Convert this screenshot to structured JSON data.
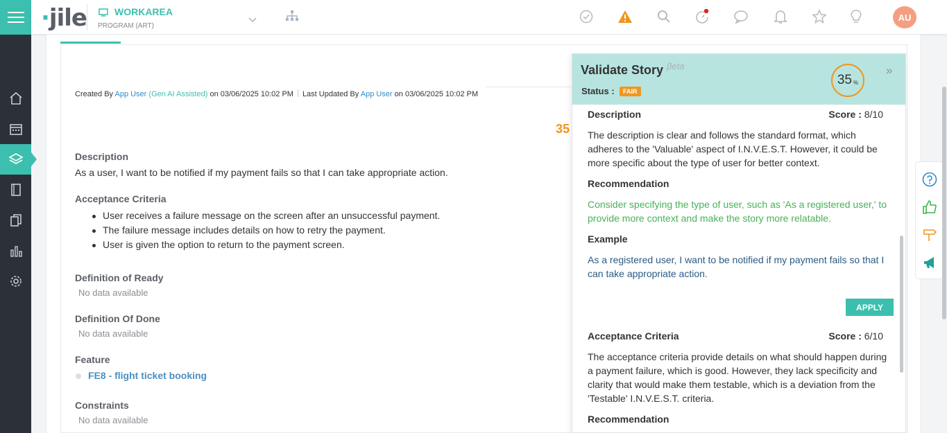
{
  "app": {
    "logo": "jile",
    "workarea_label": "WORKAREA",
    "program_label": "PROGRAM (ART)",
    "avatar_initials": "AU"
  },
  "colors": {
    "brand": "#3cbfae",
    "warning": "#f0961e",
    "link": "#2e8bc9"
  },
  "rail": {
    "items": [
      {
        "icon": "home-icon"
      },
      {
        "icon": "calendar-icon"
      },
      {
        "icon": "layers-icon",
        "active": true
      },
      {
        "icon": "notebook-icon"
      },
      {
        "icon": "documents-icon"
      },
      {
        "icon": "bar-chart-icon"
      },
      {
        "icon": "gear-icon"
      }
    ]
  },
  "topbar_icons": [
    "check-circle-icon",
    "warning-icon",
    "search-icon",
    "timer-icon",
    "chat-icon",
    "bell-icon",
    "star-icon",
    "lightbulb-icon"
  ],
  "story": {
    "meta": {
      "created_by_prefix": "Created By",
      "created_by_user": "App User",
      "created_by_note": "(Gen AI Assisted)",
      "created_on": "on 03/06/2025 10:02 PM",
      "updated_prefix": "Last Updated By",
      "updated_by_user": "App User",
      "updated_on": "on 03/06/2025 10:02 PM"
    },
    "score": "35",
    "description_label": "Description",
    "description": "As a user, I want to be notified if my payment fails so that I can take appropriate action.",
    "ac_label": "Acceptance Criteria",
    "ac_items": [
      "User receives a failure message on the screen after an unsuccessful payment.",
      "The failure message includes details on how to retry the payment.",
      "User is given the option to return to the payment screen."
    ],
    "dor_label": "Definition of Ready",
    "dor_value": "No data available",
    "dod_label": "Definition Of Done",
    "dod_value": "No data available",
    "feature_label": "Feature",
    "feature_value": "FE8 - flight ticket booking",
    "constraints_label": "Constraints",
    "constraints_value": "No data available"
  },
  "validate": {
    "title": "Validate Story",
    "beta": "βeta",
    "status_label": "Status :",
    "status_value": "FAIR",
    "score": "35",
    "score_unit": "%",
    "description": {
      "heading": "Description",
      "score_label": "Score :",
      "score_value": "8/10",
      "text": "The description is clear and follows the standard format, which adheres to the 'Valuable' aspect of I.N.V.E.S.T. However, it could be more specific about the type of user for better context.",
      "rec_heading": "Recommendation",
      "recommendation": "Consider specifying the type of user, such as 'As a registered user,' to provide more context and make the story more relatable.",
      "example_heading": "Example",
      "example": "As a registered user, I want to be notified if my payment fails so that I can take appropriate action.",
      "apply_label": "APPLY"
    },
    "acceptance": {
      "heading": "Acceptance Criteria",
      "score_label": "Score :",
      "score_value": "6/10",
      "text": "The acceptance criteria provide details on what should happen during a payment failure, which is good. However, they lack specificity and clarity that would make them testable, which is a deviation from the 'Testable' I.N.V.E.S.T. criteria.",
      "rec_heading": "Recommendation"
    }
  },
  "right_tools": [
    "help-icon",
    "thumbs-up-icon",
    "signpost-icon",
    "megaphone-icon"
  ]
}
